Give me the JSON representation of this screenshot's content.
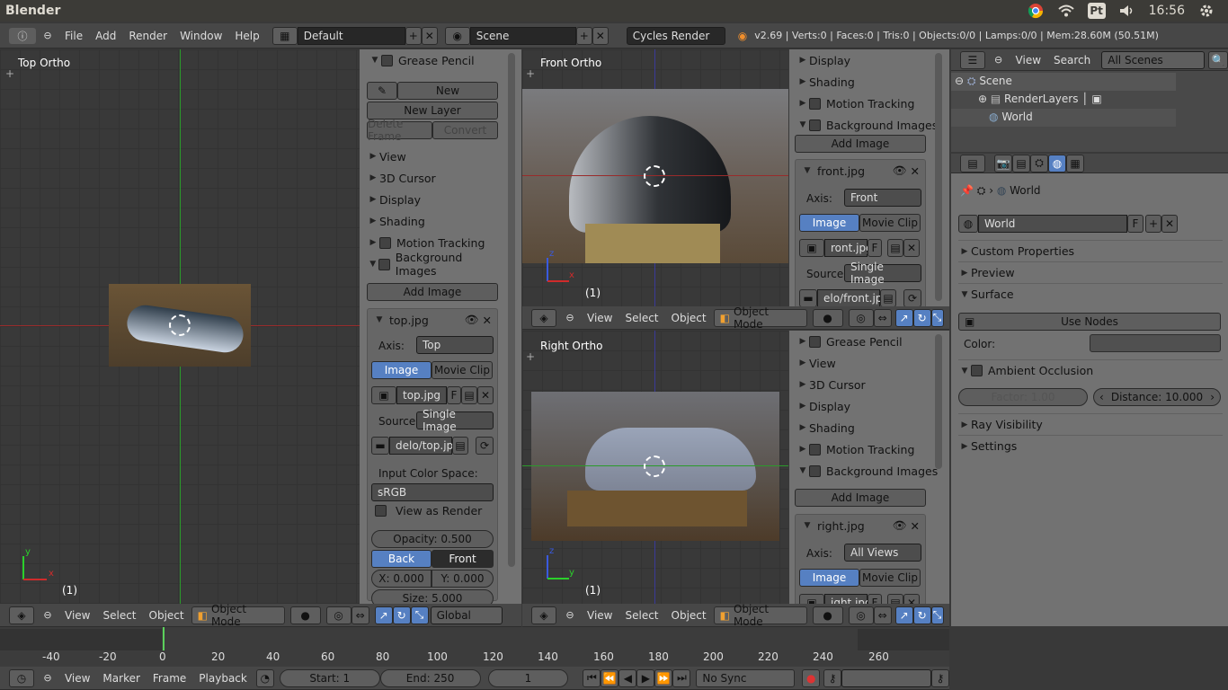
{
  "os": {
    "title": "Blender",
    "time": "16:56"
  },
  "info_header": {
    "menus": [
      "File",
      "Add",
      "Render",
      "Window",
      "Help"
    ],
    "layout": "Default",
    "scene": "Scene",
    "engine": "Cycles Render",
    "stats": "v2.69 | Verts:0 | Faces:0 | Tris:0 | Objects:0/0 | Lamps:0/0 | Mem:28.60M (50.51M)"
  },
  "top_view": {
    "label": "Top Ortho",
    "frame": "(1)",
    "axis_x": "x",
    "axis_y": "y",
    "footer_menus": [
      "View",
      "Select",
      "Object"
    ],
    "mode": "Object Mode",
    "orientation": "Global"
  },
  "left_panel": {
    "grease": {
      "title": "Grease Pencil",
      "new": "New",
      "new_layer": "New Layer",
      "delete_frame": "Delete Frame",
      "convert": "Convert"
    },
    "sections": [
      "View",
      "3D Cursor",
      "Display",
      "Shading",
      "Motion Tracking",
      "Background Images"
    ],
    "add_image": "Add Image",
    "bg": {
      "name": "top.jpg",
      "axis_label": "Axis:",
      "axis_value": "Top",
      "tab_image": "Image",
      "tab_clip": "Movie Clip",
      "img_name": "top.jpg",
      "f": "F",
      "source_label": "Source",
      "source_value": "Single Image",
      "path": "delo/top.jpg",
      "ics_label": "Input Color Space:",
      "ics_value": "sRGB",
      "view_as_render": "View as Render",
      "opacity": "Opacity: 0.500",
      "back": "Back",
      "front": "Front",
      "x": "X: 0.000",
      "y": "Y: 0.000",
      "size": "Size: 5.000"
    }
  },
  "front_view": {
    "label": "Front Ortho",
    "frame": "(1)",
    "axis_x": "x",
    "axis_z": "z",
    "footer_menus": [
      "View",
      "Select",
      "Object"
    ],
    "mode": "Object Mode"
  },
  "right_view": {
    "label": "Right Ortho",
    "frame": "(1)",
    "axis_y": "y",
    "axis_z": "z",
    "footer_menus": [
      "View",
      "Select",
      "Object"
    ],
    "mode": "Object Mode"
  },
  "front_panel": {
    "sections": [
      "Display",
      "Shading",
      "Motion Tracking",
      "Background Images"
    ],
    "add_image": "Add Image",
    "bg": {
      "name": "front.jpg",
      "axis_label": "Axis:",
      "axis_value": "Front",
      "tab_image": "Image",
      "tab_clip": "Movie Clip",
      "img_name": "ront.jpg",
      "f": "F",
      "source_label": "Source",
      "source_value": "Single Image",
      "path": "elo/front.jpg"
    }
  },
  "right_panel": {
    "sections": [
      "Grease Pencil",
      "View",
      "3D Cursor",
      "Display",
      "Shading",
      "Motion Tracking",
      "Background Images"
    ],
    "add_image": "Add Image",
    "bg": {
      "name": "right.jpg",
      "axis_label": "Axis:",
      "axis_value": "All Views",
      "tab_image": "Image",
      "tab_clip": "Movie Clip",
      "img_name": "ight.jpg",
      "f": "F"
    }
  },
  "outliner": {
    "menus": [
      "View",
      "Search"
    ],
    "filter": "All Scenes",
    "tree": [
      "Scene",
      "RenderLayers",
      "World"
    ]
  },
  "properties": {
    "breadcrumb": "World",
    "world_name": "World",
    "f": "F",
    "sections": [
      "Custom Properties",
      "Preview",
      "Surface"
    ],
    "use_nodes": "Use Nodes",
    "color_label": "Color:",
    "ambient": "Ambient Occlusion",
    "factor": "Factor: 1.00",
    "distance": "Distance: 10.000",
    "ray_visibility": "Ray Visibility",
    "settings": "Settings"
  },
  "timeline": {
    "ruler": [
      "-40",
      "-20",
      "0",
      "20",
      "40",
      "60",
      "80",
      "100",
      "120",
      "140",
      "160",
      "180",
      "200",
      "220",
      "240",
      "260"
    ],
    "menus": [
      "View",
      "Marker",
      "Frame",
      "Playback"
    ],
    "start": "Start: 1",
    "end": "End: 250",
    "current": "1",
    "sync": "No Sync"
  }
}
